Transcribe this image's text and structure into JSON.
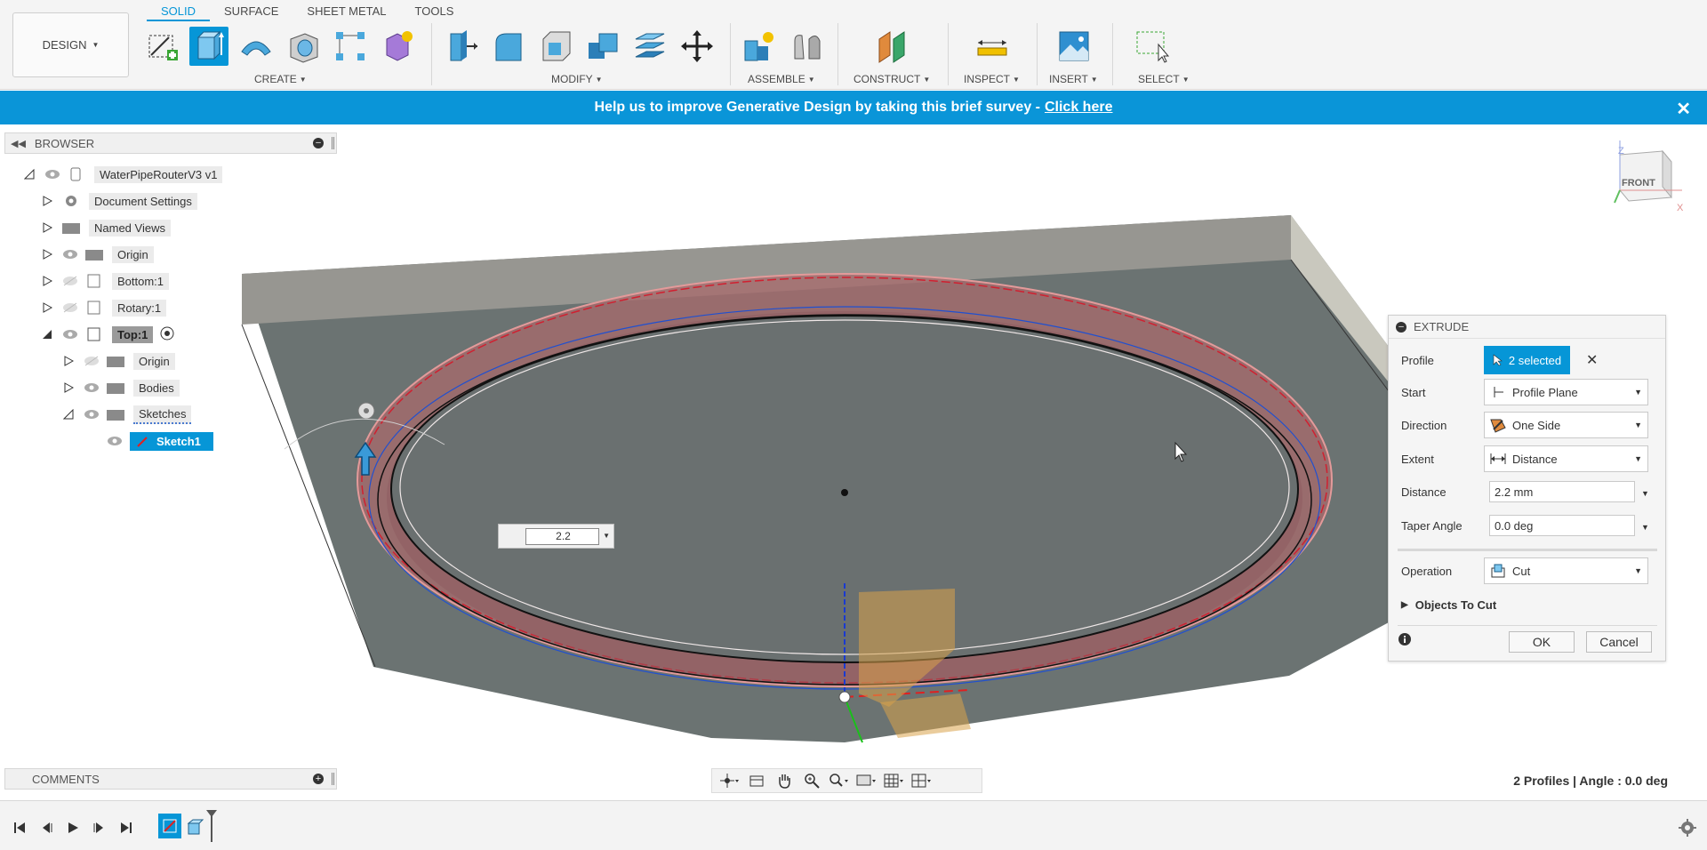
{
  "toolbar": {
    "workspace_label": "DESIGN",
    "tabs": [
      "SOLID",
      "SURFACE",
      "SHEET METAL",
      "TOOLS"
    ],
    "groups": {
      "create": "CREATE",
      "modify": "MODIFY",
      "assemble": "ASSEMBLE",
      "construct": "CONSTRUCT",
      "inspect": "INSPECT",
      "insert": "INSERT",
      "select": "SELECT"
    }
  },
  "banner": {
    "text": "Help us to improve Generative Design by taking this brief survey -",
    "link": "Click here",
    "close": "✕"
  },
  "browser": {
    "title": "BROWSER",
    "items": [
      {
        "label": "WaterPipeRouterV3 v1"
      },
      {
        "label": "Document Settings"
      },
      {
        "label": "Named Views"
      },
      {
        "label": "Origin"
      },
      {
        "label": "Bottom:1"
      },
      {
        "label": "Rotary:1"
      },
      {
        "label": "Top:1"
      },
      {
        "label": "Origin"
      },
      {
        "label": "Bodies"
      },
      {
        "label": "Sketches"
      },
      {
        "label": "Sketch1"
      }
    ]
  },
  "comments": {
    "title": "COMMENTS"
  },
  "viewcube": {
    "face": "FRONT",
    "z": "Z",
    "x": "X"
  },
  "value_input": {
    "value": "2.2"
  },
  "extrude": {
    "title": "EXTRUDE",
    "profile_label": "Profile",
    "profile_value": "2 selected",
    "start_label": "Start",
    "start_value": "Profile Plane",
    "direction_label": "Direction",
    "direction_value": "One Side",
    "extent_label": "Extent",
    "extent_value": "Distance",
    "distance_label": "Distance",
    "distance_value": "2.2 mm",
    "taper_label": "Taper Angle",
    "taper_value": "0.0 deg",
    "operation_label": "Operation",
    "operation_value": "Cut",
    "objects_label": "Objects To Cut",
    "ok": "OK",
    "cancel": "Cancel"
  },
  "status": {
    "text": "2 Profiles | Angle : 0.0 deg"
  },
  "colors": {
    "accent": "#0696d7",
    "banner": "#0a95d8",
    "cut_region": "#d97a7a"
  }
}
